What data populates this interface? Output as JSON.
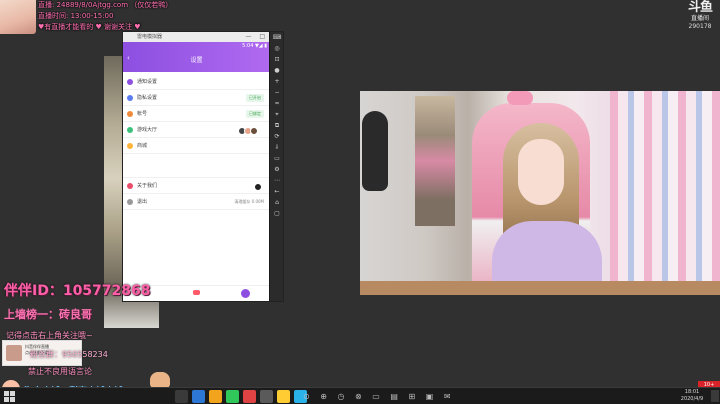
{
  "overlay_top": {
    "line1": "直播: 24889/8/0Ajtgg.com （仅仅若鸭）",
    "line2": "直播时间: 13:00-15:00",
    "line3": "♥有直播才能看的 ♥ 谢谢关注 ♥"
  },
  "logo": {
    "mark": "斗鱼",
    "name": "直播间",
    "room": "290178"
  },
  "emulator": {
    "title": "雷电模拟器",
    "controls": "— □ ✕",
    "phone_status": "5:04 ▼◢ ▮",
    "phone_title": "设置",
    "back": "‹",
    "rows": [
      {
        "label": "通知设置",
        "right": "",
        "color": "#8c4fe0"
      },
      {
        "label": "隐私设置",
        "right": "已开启",
        "color": "#5b7cf0"
      },
      {
        "label": "帐号",
        "right": "已绑定",
        "color": "#f08a3c"
      },
      {
        "label": "游戏大厅",
        "right": "",
        "color": "#3cc07a"
      },
      {
        "label": "商城",
        "right": "",
        "color": "#ffb53c"
      },
      {
        "label": "",
        "right": "",
        "color": "#ffffff"
      },
      {
        "label": "关于我们",
        "right": "",
        "color": "#e84d6b"
      },
      {
        "label": "退出",
        "right": "清理缓存 0.00M",
        "color": "#999999"
      }
    ],
    "side_icons": [
      "keyboard-icon",
      "gamepad-icon",
      "screenshot-icon",
      "record-icon",
      "volume-up-icon",
      "volume-down-icon",
      "shake-icon",
      "location-icon",
      "multi-icon",
      "sync-icon",
      "install-icon",
      "folder-icon",
      "settings-icon",
      "more-icon",
      "back-icon",
      "home-icon",
      "recent-icon"
    ],
    "side_glyphs": [
      "⌨",
      "◎",
      "⊡",
      "●",
      "+",
      "−",
      "≈",
      "⌖",
      "⧉",
      "⟳",
      "⇩",
      "▭",
      "⚙",
      "⋯",
      "←",
      "⌂",
      "▢"
    ]
  },
  "overlay_bottom": {
    "peiban": "伴伴ID：105772868",
    "shangqiang": "上墙榜一：砖良哥",
    "remember": "记得点击右上角关注哦~",
    "qq": "粉丝群：950558234",
    "rule": "禁止不良用语言论",
    "popup_title": "抖音伴伴直播",
    "popup_sub": "点击立即下载",
    "taobao": "淘宝店铺：甜蜜小铺小铺"
  },
  "taskbar": {
    "tray": "⊙ ⊕ ◷ ⊗ ▭ ▤ ⊞ ▣ ✉",
    "time": "18:01",
    "date": "2020/4/9",
    "badge": "10+",
    "app_colors": [
      "#3a3a3a",
      "#2d77d6",
      "#f2a51c",
      "#30c85a",
      "#e04343",
      "#5a5a5a",
      "#ffcc33",
      "#2ab3e8"
    ]
  }
}
